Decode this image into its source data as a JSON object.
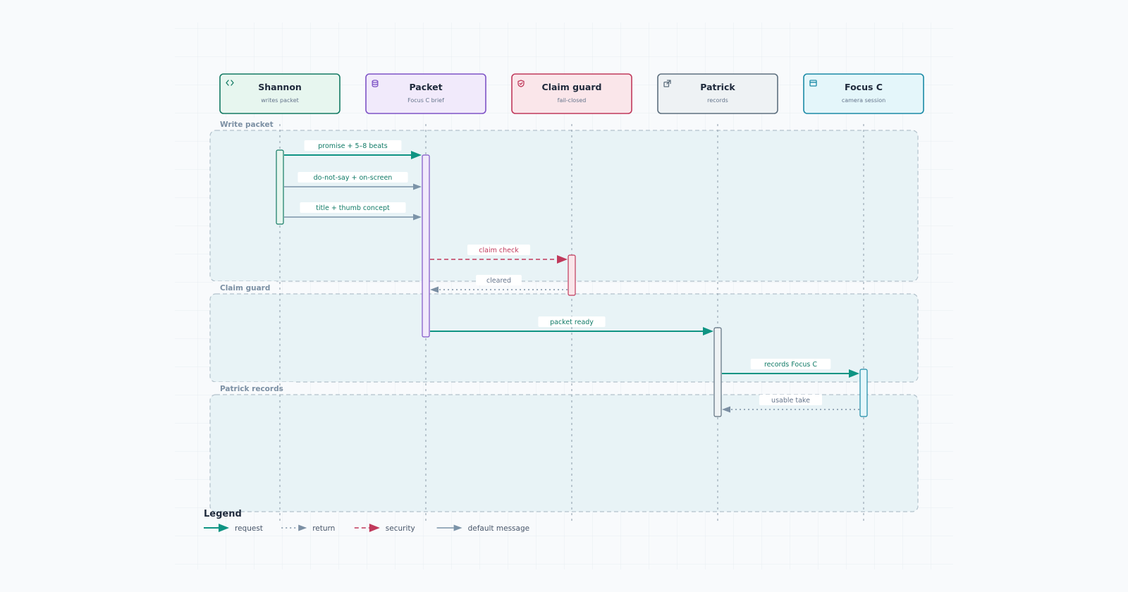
{
  "colors": {
    "background": "#f8fafc",
    "request": "#0f9483",
    "return": "#7b8fa3",
    "security": "#c0395b",
    "default": "#7b93a8",
    "group_fill": "#e8f3f6",
    "group_border": "#b3c2cc"
  },
  "participants": [
    {
      "name": "Shannon",
      "subtitle": "writes packet",
      "icon": "code-icon",
      "stroke": "#137a63",
      "fill": "#e7f6ef"
    },
    {
      "name": "Packet",
      "subtitle": "Focus C brief",
      "icon": "database-icon",
      "stroke": "#7e53c6",
      "fill": "#f1eafb"
    },
    {
      "name": "Claim guard",
      "subtitle": "fail-closed",
      "icon": "shield-icon",
      "stroke": "#c0395b",
      "fill": "#fae6ea"
    },
    {
      "name": "Patrick",
      "subtitle": "records",
      "icon": "external-link-icon",
      "stroke": "#5d6f7e",
      "fill": "#eef2f4"
    },
    {
      "name": "Focus C",
      "subtitle": "camera session",
      "icon": "window-icon",
      "stroke": "#1a8aa6",
      "fill": "#e4f6fa"
    }
  ],
  "groups": [
    {
      "label": "Write packet"
    },
    {
      "label": "Claim guard"
    },
    {
      "label": "Patrick records"
    }
  ],
  "messages": [
    {
      "label": "promise + 5–8 beats",
      "from": 0,
      "to": 1,
      "kind": "request"
    },
    {
      "label": "do-not-say + on-screen",
      "from": 0,
      "to": 1,
      "kind": "default"
    },
    {
      "label": "title + thumb concept",
      "from": 0,
      "to": 1,
      "kind": "default"
    },
    {
      "label": "claim check",
      "from": 1,
      "to": 2,
      "kind": "security"
    },
    {
      "label": "cleared",
      "from": 2,
      "to": 1,
      "kind": "return"
    },
    {
      "label": "packet ready",
      "from": 1,
      "to": 3,
      "kind": "request"
    },
    {
      "label": "records Focus C",
      "from": 3,
      "to": 4,
      "kind": "request"
    },
    {
      "label": "usable take",
      "from": 4,
      "to": 3,
      "kind": "return"
    }
  ],
  "legend": {
    "title": "Legend",
    "items": [
      {
        "label": "request",
        "kind": "request"
      },
      {
        "label": "return",
        "kind": "return"
      },
      {
        "label": "security",
        "kind": "security"
      },
      {
        "label": "default message",
        "kind": "default"
      }
    ]
  }
}
